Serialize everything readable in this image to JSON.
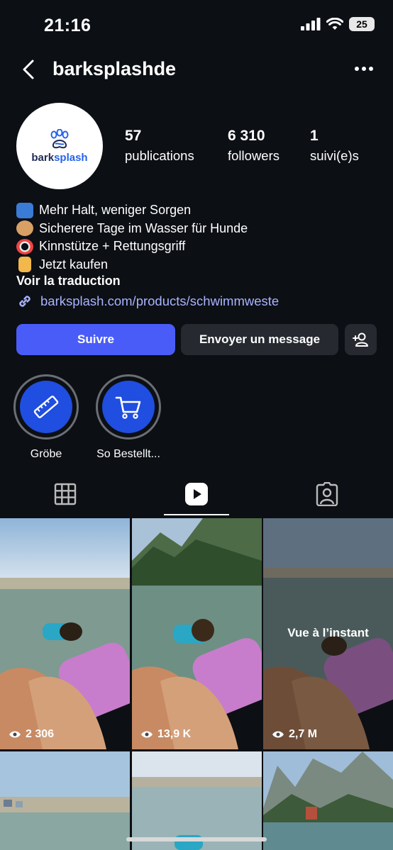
{
  "status_bar": {
    "time": "21:16",
    "battery": "25"
  },
  "header": {
    "username": "barksplashde"
  },
  "profile": {
    "logo_text_a": "bark",
    "logo_text_b": "splash",
    "stats": [
      {
        "value": "57",
        "label": "publications"
      },
      {
        "value": "6 310",
        "label": "followers"
      },
      {
        "value": "1",
        "label": "suivi(e)s"
      }
    ],
    "bio": [
      "Mehr Halt, weniger Sorgen",
      "Sicherere Tage im Wasser für Hunde",
      "Kinnstütze + Rettungsgriff",
      "Jetzt kaufen"
    ],
    "translate": "Voir la traduction",
    "link": "barksplash.com/products/schwimmweste"
  },
  "actions": {
    "follow": "Suivre",
    "message": "Envoyer un message"
  },
  "highlights": [
    {
      "label": "Gröbe"
    },
    {
      "label": "So Bestellt..."
    }
  ],
  "posts": [
    {
      "views": "2 306"
    },
    {
      "views": "13,9 K"
    },
    {
      "views": "2,7 M",
      "overlay": "Vue à l’instant"
    }
  ]
}
